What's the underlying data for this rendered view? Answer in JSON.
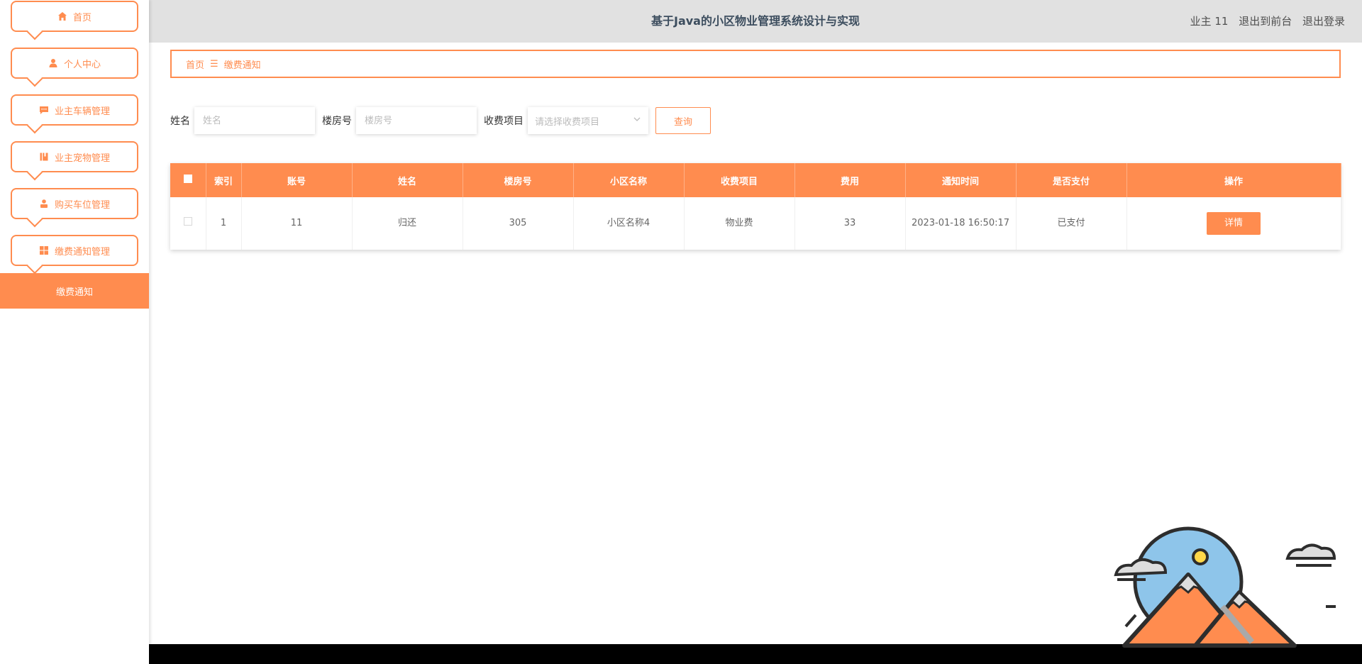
{
  "sidebar": {
    "items": [
      {
        "label": "首页",
        "icon": "home-icon"
      },
      {
        "label": "个人中心",
        "icon": "user-icon"
      },
      {
        "label": "业主车辆管理",
        "icon": "chat-icon"
      },
      {
        "label": "业主宠物管理",
        "icon": "book-icon"
      },
      {
        "label": "购买车位管理",
        "icon": "person-icon"
      },
      {
        "label": "缴费通知管理",
        "icon": "grid-icon"
      }
    ],
    "active_sub": "缴费通知"
  },
  "header": {
    "title": "基于Java的小区物业管理系统设计与实现",
    "user": "业主 11",
    "exit_front": "退出到前台",
    "logout": "退出登录"
  },
  "breadcrumb": {
    "home": "首页",
    "separator": "☰",
    "current": "缴费通知"
  },
  "search": {
    "name_label": "姓名",
    "name_placeholder": "姓名",
    "room_label": "楼房号",
    "room_placeholder": "楼房号",
    "item_label": "收费项目",
    "item_placeholder": "请选择收费项目",
    "query_button": "查询"
  },
  "table": {
    "columns": [
      "索引",
      "账号",
      "姓名",
      "楼房号",
      "小区名称",
      "收费项目",
      "费用",
      "通知时间",
      "是否支付",
      "操作"
    ],
    "rows": [
      {
        "index": "1",
        "account": "11",
        "name": "归还",
        "room": "305",
        "community": "小区名称4",
        "item": "物业费",
        "fee": "33",
        "time": "2023-01-18 16:50:17",
        "paid": "已支付",
        "action": "详情"
      }
    ]
  },
  "colors": {
    "accent": "#ff8c4f",
    "header_bg": "#e1e1e1"
  }
}
